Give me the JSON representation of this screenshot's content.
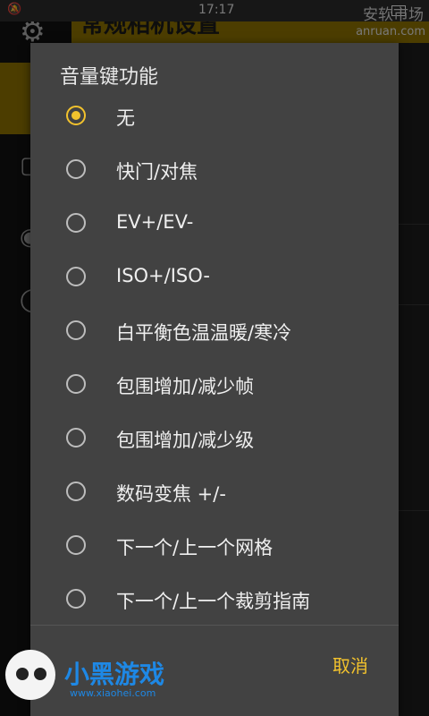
{
  "background": {
    "status_time": "17:17",
    "page_title": "常规相机设置",
    "watermark": "安软市场",
    "watermark_url": "anruan.com"
  },
  "dialog": {
    "title": "音量键功能",
    "selected_index": 0,
    "options": [
      "无",
      "快门/对焦",
      "EV+/EV-",
      "ISO+/ISO-",
      "白平衡色温温暖/寒冷",
      "包围增加/减少帧",
      "包围增加/减少级",
      "数码变焦 +/-",
      "下一个/上一个网格",
      "下一个/上一个裁剪指南"
    ],
    "cancel_label": "取消"
  },
  "logo": {
    "text": "小黑游戏",
    "url": "www.xiaohei.com"
  },
  "colors": {
    "accent": "#f2c22d",
    "dialog_bg": "#424242",
    "appbar": "#8a7000"
  }
}
